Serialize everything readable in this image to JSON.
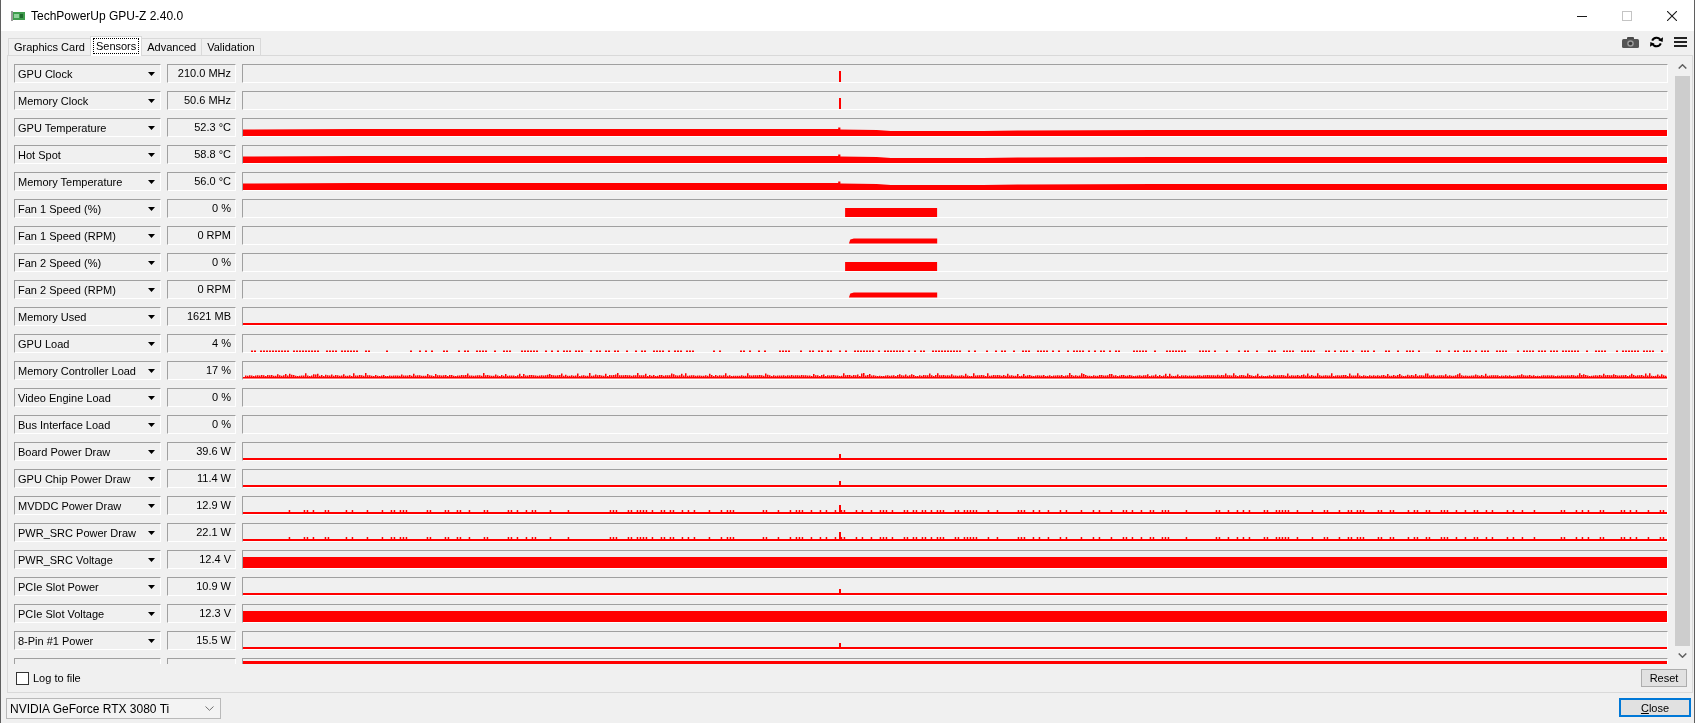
{
  "window": {
    "title": "TechPowerUp GPU-Z 2.40.0",
    "controls": [
      {
        "kind": "minimize",
        "disabled": false
      },
      {
        "kind": "maximize",
        "disabled": true
      },
      {
        "kind": "close",
        "disabled": false
      }
    ]
  },
  "tabs": [
    {
      "label": "Graphics Card",
      "selected": false
    },
    {
      "label": "Sensors",
      "selected": true
    },
    {
      "label": "Advanced",
      "selected": false
    },
    {
      "label": "Validation",
      "selected": false
    }
  ],
  "toolbar": [
    {
      "kind": "camera"
    },
    {
      "kind": "refresh"
    },
    {
      "kind": "menu"
    }
  ],
  "sensors": [
    {
      "name": "GPU Clock",
      "value": "210.0 MHz",
      "kind": "spike"
    },
    {
      "name": "Memory Clock",
      "value": "50.6 MHz",
      "kind": "spike"
    },
    {
      "name": "GPU Temperature",
      "value": "52.3 °C",
      "kind": "band"
    },
    {
      "name": "Hot Spot",
      "value": "58.8 °C",
      "kind": "band"
    },
    {
      "name": "Memory Temperature",
      "value": "56.0 °C",
      "kind": "band"
    },
    {
      "name": "Fan 1 Speed (%)",
      "value": "0 %",
      "kind": "block"
    },
    {
      "name": "Fan 1 Speed (RPM)",
      "value": "0 RPM",
      "kind": "bar"
    },
    {
      "name": "Fan 2 Speed (%)",
      "value": "0 %",
      "kind": "block"
    },
    {
      "name": "Fan 2 Speed (RPM)",
      "value": "0 RPM",
      "kind": "bar"
    },
    {
      "name": "Memory Used",
      "value": "1621 MB",
      "kind": "line"
    },
    {
      "name": "GPU Load",
      "value": "4 %",
      "kind": "dotted"
    },
    {
      "name": "Memory Controller Load",
      "value": "17 %",
      "kind": "noisy"
    },
    {
      "name": "Video Engine Load",
      "value": "0 %",
      "kind": "empty"
    },
    {
      "name": "Bus Interface Load",
      "value": "0 %",
      "kind": "empty"
    },
    {
      "name": "Board Power Draw",
      "value": "39.6 W",
      "kind": "line-spike"
    },
    {
      "name": "GPU Chip Power Draw",
      "value": "11.4 W",
      "kind": "line-spike"
    },
    {
      "name": "MVDDC Power Draw",
      "value": "12.9 W",
      "kind": "line-noise"
    },
    {
      "name": "PWR_SRC Power Draw",
      "value": "22.1 W",
      "kind": "line-noise"
    },
    {
      "name": "PWR_SRC Voltage",
      "value": "12.4 V",
      "kind": "full"
    },
    {
      "name": "PCIe Slot Power",
      "value": "10.9 W",
      "kind": "line-spike"
    },
    {
      "name": "PCIe Slot Voltage",
      "value": "12.3 V",
      "kind": "full"
    },
    {
      "name": "8-Pin #1 Power",
      "value": "15.5 W",
      "kind": "line-spike"
    },
    {
      "kind": "tall"
    }
  ],
  "log_to_file": {
    "label": "Log to file",
    "checked": false
  },
  "reset_button": "Reset",
  "device": {
    "value": "NVIDIA GeForce RTX 3080 Ti"
  },
  "close_button": "Close"
}
